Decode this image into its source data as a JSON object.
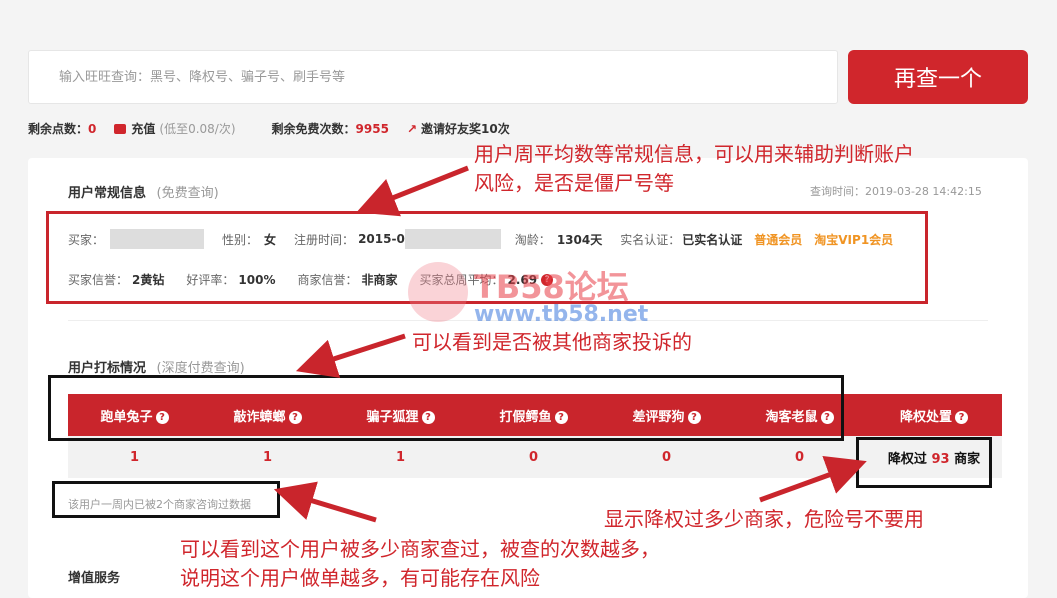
{
  "search": {
    "placeholder": "输入旺旺查询：黑号、降权号、骗子号、刷手号等",
    "button_label": "再查一个"
  },
  "status": {
    "points_label": "剩余点数：",
    "points_value": "0",
    "recharge_label": "充值",
    "recharge_note": "(低至0.08/次)",
    "free_label": "剩余免费次数：",
    "free_value": "9955",
    "invite_label": "邀请好友奖10次"
  },
  "general_info": {
    "title": "用户常规信息",
    "subtitle": "(免费查询)",
    "query_time": "查询时间：2019-03-28 14:42:15",
    "buyer_label": "买家：",
    "gender_label": "性别：",
    "gender_value": "女",
    "reg_label": "注册时间：",
    "reg_value": "2015-0",
    "age_label": "淘龄：",
    "age_value": "1304天",
    "verify_label": "实名认证：",
    "verify_value": "已实名认证",
    "member1": "普通会员",
    "member2": "淘宝VIP1会员",
    "credit_label": "买家信誉：",
    "credit_value": "2黄钻",
    "rate_label": "好评率：",
    "rate_value": "100%",
    "seller_label": "商家信誉：",
    "seller_value": "非商家",
    "weekly_label": "买家总周平均：",
    "weekly_value": "2.69"
  },
  "mark_info": {
    "title": "用户打标情况",
    "subtitle": "(深度付费查询)",
    "columns": [
      "跑单兔子",
      "敲诈蟑螂",
      "骗子狐狸",
      "打假鳄鱼",
      "差评野狗",
      "淘客老鼠",
      "降权处置"
    ],
    "values": [
      "1",
      "1",
      "1",
      "0",
      "0",
      "0"
    ],
    "demote_prefix": "降权过",
    "demote_count": "93",
    "demote_suffix": "商家",
    "week_note": "该用户一周内已被2个商家咨询过数据"
  },
  "value_added": {
    "title": "增值服务"
  },
  "annotations": {
    "note1_line1": "用户周平均数等常规信息，可以用来辅助判断账户",
    "note1_line2": "风险，是否是僵尸号等",
    "note2": "可以看到是否被其他商家投诉的",
    "note3": "显示降权过多少商家，危险号不要用",
    "note4_line1": "可以看到这个用户被多少商家查过，被查的次数越多，",
    "note4_line2": "说明这个用户做单越多，有可能存在风险"
  },
  "watermark": {
    "title": "TB58论坛",
    "url": "www.tb58.net"
  },
  "colors": {
    "brand_red": "#d0262c",
    "orange": "#f09423"
  }
}
